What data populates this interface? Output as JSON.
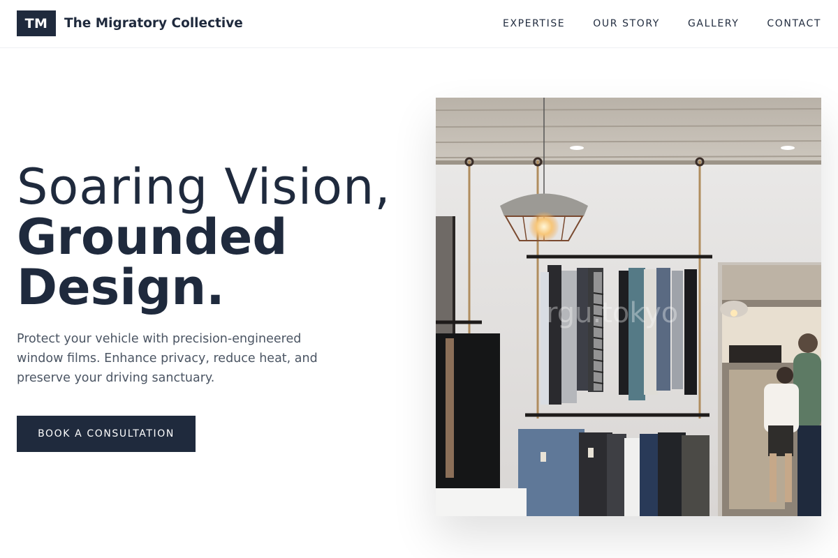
{
  "header": {
    "logo_mark": "TM",
    "brand_name": "The Migratory Collective",
    "nav": [
      {
        "label": "EXPERTISE"
      },
      {
        "label": "OUR STORY"
      },
      {
        "label": "GALLERY"
      },
      {
        "label": "CONTACT"
      }
    ]
  },
  "hero": {
    "headline_light": "Soaring Vision,",
    "headline_bold_1": "Grounded",
    "headline_bold_2": "Design.",
    "description": "Protect your vehicle with precision-engineered window films. Enhance privacy, reduce heat, and preserve your driving sanctuary.",
    "cta_label": "BOOK A CONSULTATION",
    "image_watermark": "rgu.tokyo"
  },
  "colors": {
    "primary": "#1f2a3d",
    "text_muted": "#4b5563",
    "background": "#ffffff"
  }
}
